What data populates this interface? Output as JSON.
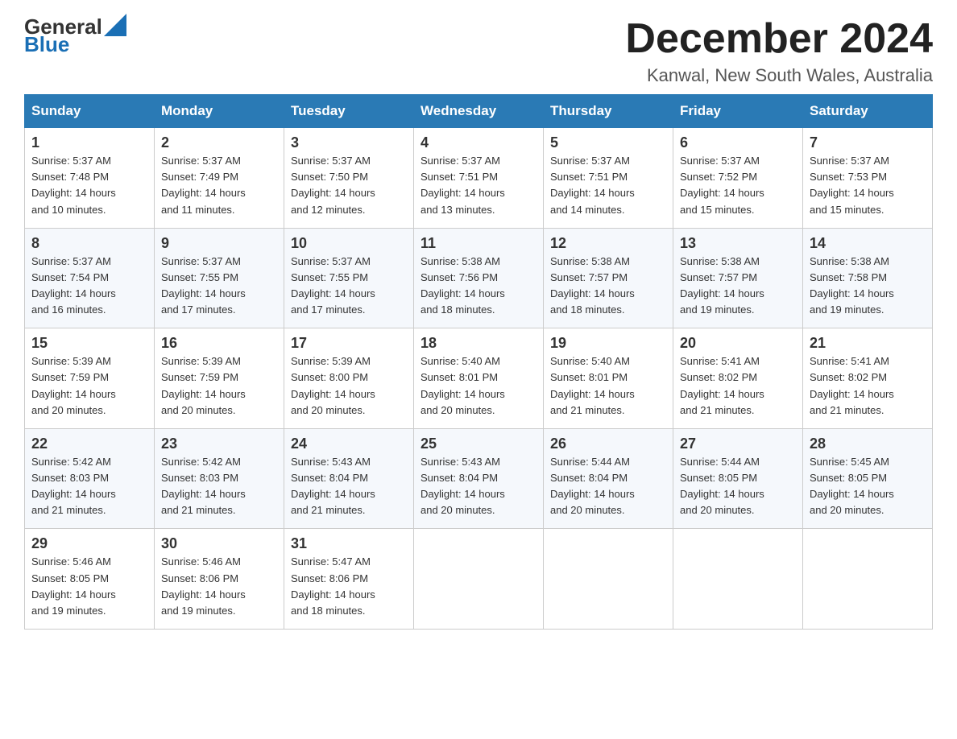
{
  "logo": {
    "text_general": "General",
    "text_blue": "Blue"
  },
  "title": "December 2024",
  "location": "Kanwal, New South Wales, Australia",
  "headers": [
    "Sunday",
    "Monday",
    "Tuesday",
    "Wednesday",
    "Thursday",
    "Friday",
    "Saturday"
  ],
  "weeks": [
    [
      {
        "day": "1",
        "sunrise": "5:37 AM",
        "sunset": "7:48 PM",
        "daylight": "14 hours and 10 minutes."
      },
      {
        "day": "2",
        "sunrise": "5:37 AM",
        "sunset": "7:49 PM",
        "daylight": "14 hours and 11 minutes."
      },
      {
        "day": "3",
        "sunrise": "5:37 AM",
        "sunset": "7:50 PM",
        "daylight": "14 hours and 12 minutes."
      },
      {
        "day": "4",
        "sunrise": "5:37 AM",
        "sunset": "7:51 PM",
        "daylight": "14 hours and 13 minutes."
      },
      {
        "day": "5",
        "sunrise": "5:37 AM",
        "sunset": "7:51 PM",
        "daylight": "14 hours and 14 minutes."
      },
      {
        "day": "6",
        "sunrise": "5:37 AM",
        "sunset": "7:52 PM",
        "daylight": "14 hours and 15 minutes."
      },
      {
        "day": "7",
        "sunrise": "5:37 AM",
        "sunset": "7:53 PM",
        "daylight": "14 hours and 15 minutes."
      }
    ],
    [
      {
        "day": "8",
        "sunrise": "5:37 AM",
        "sunset": "7:54 PM",
        "daylight": "14 hours and 16 minutes."
      },
      {
        "day": "9",
        "sunrise": "5:37 AM",
        "sunset": "7:55 PM",
        "daylight": "14 hours and 17 minutes."
      },
      {
        "day": "10",
        "sunrise": "5:37 AM",
        "sunset": "7:55 PM",
        "daylight": "14 hours and 17 minutes."
      },
      {
        "day": "11",
        "sunrise": "5:38 AM",
        "sunset": "7:56 PM",
        "daylight": "14 hours and 18 minutes."
      },
      {
        "day": "12",
        "sunrise": "5:38 AM",
        "sunset": "7:57 PM",
        "daylight": "14 hours and 18 minutes."
      },
      {
        "day": "13",
        "sunrise": "5:38 AM",
        "sunset": "7:57 PM",
        "daylight": "14 hours and 19 minutes."
      },
      {
        "day": "14",
        "sunrise": "5:38 AM",
        "sunset": "7:58 PM",
        "daylight": "14 hours and 19 minutes."
      }
    ],
    [
      {
        "day": "15",
        "sunrise": "5:39 AM",
        "sunset": "7:59 PM",
        "daylight": "14 hours and 20 minutes."
      },
      {
        "day": "16",
        "sunrise": "5:39 AM",
        "sunset": "7:59 PM",
        "daylight": "14 hours and 20 minutes."
      },
      {
        "day": "17",
        "sunrise": "5:39 AM",
        "sunset": "8:00 PM",
        "daylight": "14 hours and 20 minutes."
      },
      {
        "day": "18",
        "sunrise": "5:40 AM",
        "sunset": "8:01 PM",
        "daylight": "14 hours and 20 minutes."
      },
      {
        "day": "19",
        "sunrise": "5:40 AM",
        "sunset": "8:01 PM",
        "daylight": "14 hours and 21 minutes."
      },
      {
        "day": "20",
        "sunrise": "5:41 AM",
        "sunset": "8:02 PM",
        "daylight": "14 hours and 21 minutes."
      },
      {
        "day": "21",
        "sunrise": "5:41 AM",
        "sunset": "8:02 PM",
        "daylight": "14 hours and 21 minutes."
      }
    ],
    [
      {
        "day": "22",
        "sunrise": "5:42 AM",
        "sunset": "8:03 PM",
        "daylight": "14 hours and 21 minutes."
      },
      {
        "day": "23",
        "sunrise": "5:42 AM",
        "sunset": "8:03 PM",
        "daylight": "14 hours and 21 minutes."
      },
      {
        "day": "24",
        "sunrise": "5:43 AM",
        "sunset": "8:04 PM",
        "daylight": "14 hours and 21 minutes."
      },
      {
        "day": "25",
        "sunrise": "5:43 AM",
        "sunset": "8:04 PM",
        "daylight": "14 hours and 20 minutes."
      },
      {
        "day": "26",
        "sunrise": "5:44 AM",
        "sunset": "8:04 PM",
        "daylight": "14 hours and 20 minutes."
      },
      {
        "day": "27",
        "sunrise": "5:44 AM",
        "sunset": "8:05 PM",
        "daylight": "14 hours and 20 minutes."
      },
      {
        "day": "28",
        "sunrise": "5:45 AM",
        "sunset": "8:05 PM",
        "daylight": "14 hours and 20 minutes."
      }
    ],
    [
      {
        "day": "29",
        "sunrise": "5:46 AM",
        "sunset": "8:05 PM",
        "daylight": "14 hours and 19 minutes."
      },
      {
        "day": "30",
        "sunrise": "5:46 AM",
        "sunset": "8:06 PM",
        "daylight": "14 hours and 19 minutes."
      },
      {
        "day": "31",
        "sunrise": "5:47 AM",
        "sunset": "8:06 PM",
        "daylight": "14 hours and 18 minutes."
      },
      null,
      null,
      null,
      null
    ]
  ],
  "labels": {
    "sunrise": "Sunrise:",
    "sunset": "Sunset:",
    "daylight": "Daylight:"
  }
}
